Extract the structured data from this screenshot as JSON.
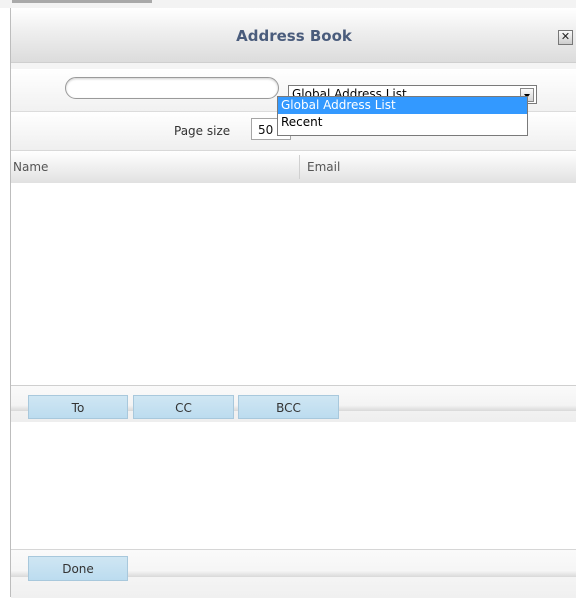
{
  "dialog": {
    "title": "Address Book",
    "close_label": "✕"
  },
  "search": {
    "query": "",
    "placeholder": "",
    "icon": "search-icon"
  },
  "source_select": {
    "selected": "Global Address List",
    "options": [
      "Global Address List",
      "Recent"
    ],
    "highlighted_index": 0
  },
  "paging": {
    "label": "Page size",
    "value": "50"
  },
  "results_table": {
    "columns": [
      "Name",
      "Email"
    ],
    "rows": []
  },
  "recipient_buttons": {
    "to": "To",
    "cc": "CC",
    "bcc": "BCC"
  },
  "footer": {
    "done_label": "Done"
  },
  "colors": {
    "title_text": "#4a5c7c",
    "button_fill": "#c7e1f1",
    "dropdown_highlight": "#3399ff"
  }
}
